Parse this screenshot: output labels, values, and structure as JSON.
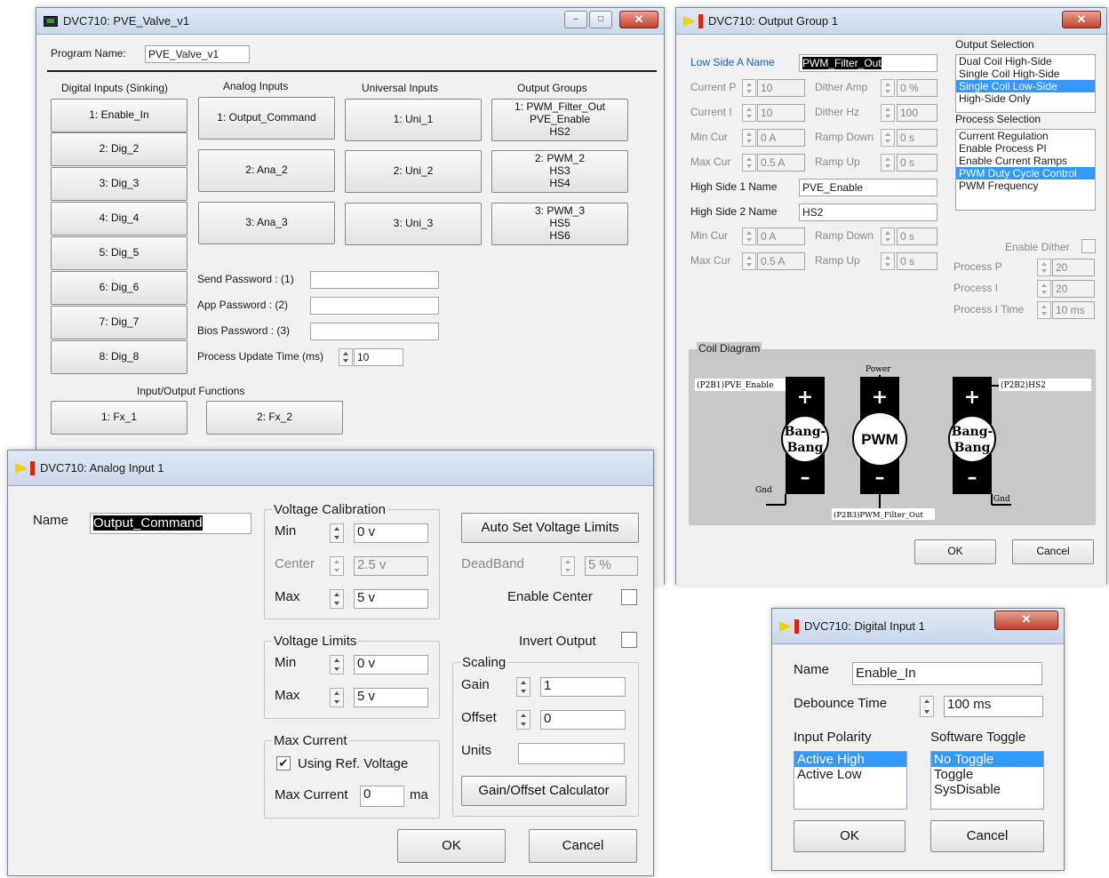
{
  "main": {
    "title": "DVC710: PVE_Valve_v1",
    "program_name_label": "Program Name:",
    "program_name_value": "PVE_Valve_v1",
    "digital_header": "Digital Inputs (Sinking)",
    "analog_header": "Analog Inputs",
    "universal_header": "Universal Inputs",
    "output_header": "Output Groups",
    "digital": [
      "1: Enable_In",
      "2: Dig_2",
      "3: Dig_3",
      "4: Dig_4",
      "5: Dig_5",
      "6: Dig_6",
      "7: Dig_7",
      "8: Dig_8"
    ],
    "analog": [
      "1: Output_Command",
      "2: Ana_2",
      "3: Ana_3"
    ],
    "universal": [
      "1: Uni_1",
      "2: Uni_2",
      "3: Uni_3"
    ],
    "outputs": [
      [
        "1: PWM_Filter_Out",
        "PVE_Enable",
        "HS2"
      ],
      [
        "2: PWM_2",
        "HS3",
        "HS4"
      ],
      [
        "3: PWM_3",
        "HS5",
        "HS6"
      ]
    ],
    "send_password": "Send Password : (1)",
    "app_password": "App Password : (2)",
    "bios_password": "Bios Password : (3)",
    "process_update": "Process Update Time (ms)",
    "process_update_value": "10",
    "io_functions_header": "Input/Output Functions",
    "functions": [
      "1: Fx_1",
      "2: Fx_2"
    ]
  },
  "output_group": {
    "title": "DVC710: Output Group 1",
    "low_side_label": "Low Side A Name",
    "low_side_value": "PWM_Filter_Out",
    "current_p": "Current P",
    "current_p_value": "10",
    "current_i": "Current I",
    "current_i_value": "10",
    "min_cur": "Min Cur",
    "min_cur_value": "0 A",
    "max_cur": "Max Cur",
    "max_cur_value": "0.5 A",
    "dither_amp": "Dither Amp",
    "dither_amp_value": "0 %",
    "dither_hz": "Dither Hz",
    "dither_hz_value": "100",
    "ramp_down": "Ramp Down",
    "ramp_down_value": "0 s",
    "ramp_up": "Ramp Up",
    "ramp_up_value": "0 s",
    "hs1_label": "High Side 1 Name",
    "hs1_value": "PVE_Enable",
    "hs2_label": "High Side 2 Name",
    "hs2_value": "HS2",
    "min_cur2_value": "0 A",
    "max_cur2_value": "0.5 A",
    "ramp_down2_value": "0 s",
    "ramp_up2_value": "0 s",
    "output_selection_label": "Output Selection",
    "output_selection": [
      "Dual Coil High-Side",
      "Single Coil High-Side",
      "Single Coil Low-Side",
      "High-Side Only"
    ],
    "output_selected_index": 2,
    "process_selection_label": "Process Selection",
    "process_selection": [
      "Current Regulation",
      "Enable Process PI",
      "Enable Current Ramps",
      "PWM Duty Cycle Control",
      "PWM Frequency"
    ],
    "process_selected_index": 3,
    "enable_dither": "Enable Dither",
    "process_p": "Process P",
    "process_p_value": "20",
    "process_i": "Process I",
    "process_i_value": "20",
    "process_i_time": "Process I Time",
    "process_i_time_value": "10 ms",
    "coil_diagram": "Coil Diagram",
    "coil_power": "Power",
    "coil_left_label": "(P2B1)PVE_Enable",
    "coil_right_label": "(P2B2)HS2",
    "coil_bottom_label": "(P2B3)PWM_Filter_Out",
    "coil_gnd": "Gnd",
    "coil_left": [
      "Bang-",
      "Bang"
    ],
    "coil_mid": "PWM",
    "coil_right": [
      "Bang-",
      "Bang"
    ],
    "ok": "OK",
    "cancel": "Cancel"
  },
  "analog_input": {
    "title": "DVC710: Analog Input 1",
    "name_label": "Name",
    "name_value": "Output_Command",
    "voltage_cal": "Voltage Calibration",
    "min": "Min",
    "min_value": "0 v",
    "center": "Center",
    "center_value": "2.5 v",
    "max": "Max",
    "max_value": "5 v",
    "auto_set": "Auto Set Voltage Limits",
    "deadband": "DeadBand",
    "deadband_value": "5 %",
    "enable_center": "Enable Center",
    "voltage_limits": "Voltage Limits",
    "lim_min_value": "0 v",
    "lim_max_value": "5 v",
    "invert_output": "Invert Output",
    "scaling": "Scaling",
    "gain": "Gain",
    "gain_value": "1",
    "offset": "Offset",
    "offset_value": "0",
    "units": "Units",
    "units_value": "",
    "max_current_group": "Max Current",
    "using_ref": "Using Ref. Voltage",
    "max_current_label": "Max Current",
    "max_current_value": "0",
    "ma": "ma",
    "calc": "Gain/Offset Calculator",
    "ok": "OK",
    "cancel": "Cancel"
  },
  "digital_input": {
    "title": "DVC710: Digital Input 1",
    "name_label": "Name",
    "name_value": "Enable_In",
    "debounce_label": "Debounce Time",
    "debounce_value": "100 ms",
    "polarity_label": "Input Polarity",
    "polarity": [
      "Active High",
      "Active Low"
    ],
    "toggle_label": "Software Toggle",
    "toggle": [
      "No Toggle",
      "Toggle",
      "SysDisable"
    ],
    "ok": "OK",
    "cancel": "Cancel"
  },
  "colors": {
    "selection": "#3399ff",
    "title_gradient_top": "#dfe9f5",
    "close_red": "#c4412c"
  }
}
